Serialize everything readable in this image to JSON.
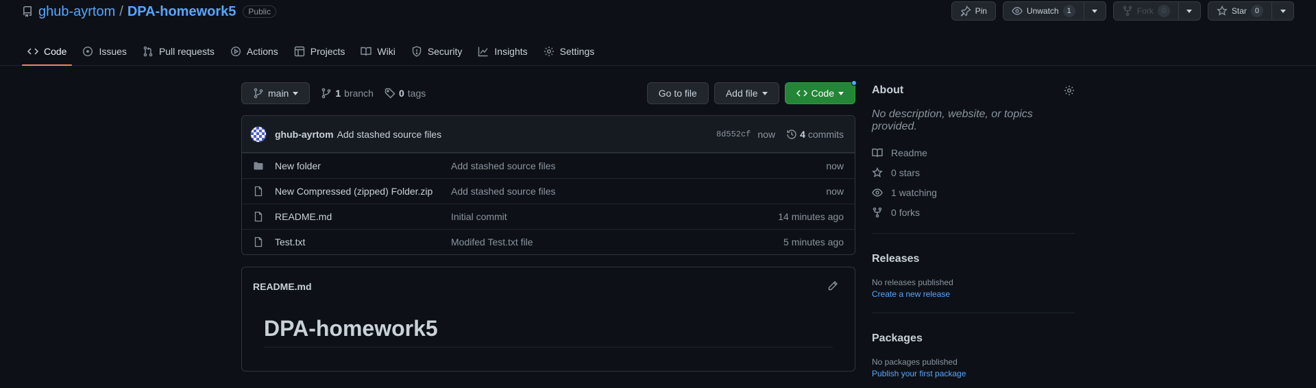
{
  "repo": {
    "owner": "ghub-ayrtom",
    "separator": "/",
    "name": "DPA-homework5",
    "visibility": "Public"
  },
  "actions": {
    "pin": "Pin",
    "unwatch": "Unwatch",
    "unwatch_count": "1",
    "fork": "Fork",
    "fork_count": "0",
    "star": "Star",
    "star_count": "0"
  },
  "tabs": [
    {
      "label": "Code",
      "icon": "code-icon",
      "active": true
    },
    {
      "label": "Issues",
      "icon": "issue-icon"
    },
    {
      "label": "Pull requests",
      "icon": "pull-request-icon"
    },
    {
      "label": "Actions",
      "icon": "play-icon"
    },
    {
      "label": "Projects",
      "icon": "table-icon"
    },
    {
      "label": "Wiki",
      "icon": "book-icon"
    },
    {
      "label": "Security",
      "icon": "shield-icon"
    },
    {
      "label": "Insights",
      "icon": "graph-icon"
    },
    {
      "label": "Settings",
      "icon": "gear-icon"
    }
  ],
  "toolbar": {
    "branch": "main",
    "branch_count": "1",
    "branch_label": "branch",
    "tag_count": "0",
    "tag_label": "tags",
    "go_to_file": "Go to file",
    "add_file": "Add file",
    "code": "Code"
  },
  "commit": {
    "author": "ghub-ayrtom",
    "message": "Add stashed source files",
    "sha": "8d552cf",
    "when": "now",
    "count": "4",
    "count_label": "commits"
  },
  "files": [
    {
      "name": "New folder",
      "type": "folder",
      "message": "Add stashed source files",
      "date": "now"
    },
    {
      "name": "New Compressed (zipped) Folder.zip",
      "type": "file",
      "message": "Add stashed source files",
      "date": "now"
    },
    {
      "name": "README.md",
      "type": "file",
      "message": "Initial commit",
      "date": "14 minutes ago"
    },
    {
      "name": "Test.txt",
      "type": "file",
      "message": "Modifed Test.txt file",
      "date": "5 minutes ago"
    }
  ],
  "readme": {
    "filename": "README.md",
    "heading": "DPA-homework5"
  },
  "about": {
    "title": "About",
    "description": "No description, website, or topics provided.",
    "readme": "Readme",
    "stars_count": "0",
    "stars_label": "stars",
    "watching_count": "1",
    "watching_label": "watching",
    "forks_count": "0",
    "forks_label": "forks"
  },
  "releases": {
    "title": "Releases",
    "note": "No releases published",
    "cta": "Create a new release"
  },
  "packages": {
    "title": "Packages",
    "note": "No packages published",
    "cta": "Publish your first package"
  },
  "colors": {
    "background": "#0d1117",
    "link": "#58a6ff",
    "green_button": "#238636",
    "active_tab_underline": "#f78166"
  }
}
